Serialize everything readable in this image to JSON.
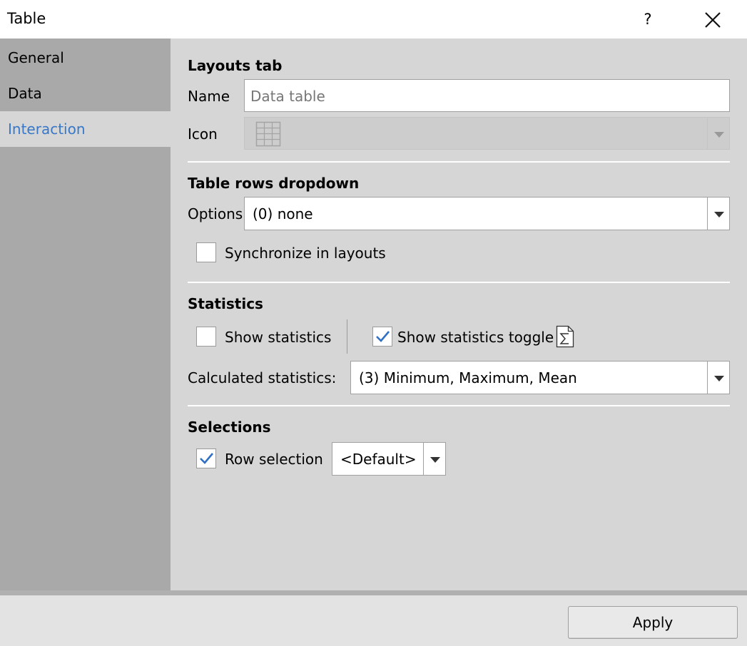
{
  "window": {
    "title": "Table",
    "help_label": "?"
  },
  "sidebar": {
    "items": [
      {
        "label": "General"
      },
      {
        "label": "Data"
      },
      {
        "label": "Interaction"
      }
    ]
  },
  "layouts_tab": {
    "heading": "Layouts tab",
    "name_label": "Name",
    "name_placeholder": "Data table",
    "icon_label": "Icon"
  },
  "table_rows": {
    "heading": "Table rows dropdown",
    "options_label": "Options",
    "options_value": "(0) none",
    "sync_label": "Synchronize in layouts",
    "sync_checked": false
  },
  "statistics": {
    "heading": "Statistics",
    "show_label": "Show statistics",
    "show_checked": false,
    "toggle_label": "Show statistics toggle",
    "toggle_checked": true,
    "calc_label": "Calculated statistics:",
    "calc_value": "(3) Minimum, Maximum, Mean"
  },
  "selections": {
    "heading": "Selections",
    "row_label": "Row selection",
    "row_checked": true,
    "row_value": "<Default>"
  },
  "footer": {
    "apply_label": "Apply"
  },
  "colors": {
    "sidebar_bg": "#a9a9a9",
    "content_bg": "#d6d6d6",
    "active_nav": "#3878c7",
    "check": "#2f6fc4"
  },
  "icons": [
    "help-icon",
    "close-icon",
    "table-grid-icon",
    "chevron-down-icon",
    "sigma-icon",
    "checkmark-icon"
  ]
}
